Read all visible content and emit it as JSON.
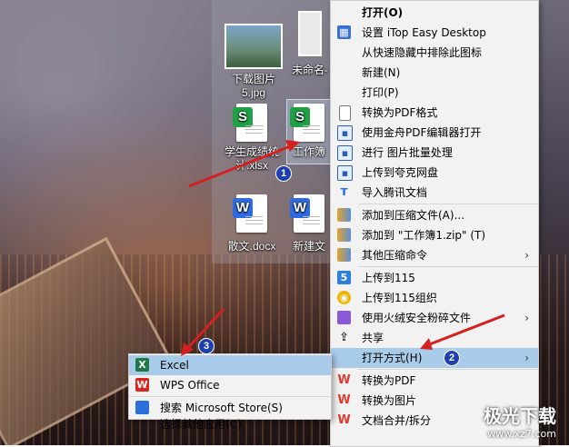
{
  "desktop": {
    "icons": [
      {
        "label": "下载图片5.jpg",
        "label_l1": "下载图片",
        "label_l2": "5.jpg"
      },
      {
        "label": "未命名-",
        "label_l1": "未命名-"
      },
      {
        "label": "学生成绩统计.xlsx",
        "label_l1": "学生成绩统",
        "label_l2": "计.xlsx",
        "badge": "S"
      },
      {
        "label": "工作簿1",
        "label_l1": "工作簿",
        "badge": "S"
      },
      {
        "label": "散文.docx",
        "label_l1": "散文.docx",
        "badge": "W"
      },
      {
        "label": "新建文",
        "label_l1": "新建文",
        "badge": "W"
      }
    ]
  },
  "context_menu": {
    "items": [
      {
        "label": "打开(O)",
        "icon": ""
      },
      {
        "label": "设置 iTop Easy Desktop",
        "icon": "itop-icon"
      },
      {
        "label": "从快速隐藏中排除此图标",
        "icon": ""
      },
      {
        "label": "新建(N)",
        "icon": ""
      },
      {
        "label": "打印(P)",
        "icon": ""
      },
      {
        "label": "转换为PDF格式",
        "icon": "document-icon"
      },
      {
        "label": "使用金舟PDF编辑器打开",
        "icon": "pdf-editor-icon"
      },
      {
        "label": "进行 图片批量处理",
        "icon": "image-batch-icon"
      },
      {
        "label": "上传到夸克网盘",
        "icon": "cloud-icon"
      },
      {
        "label": "导入腾讯文档",
        "icon": "tencent-docs-icon"
      },
      {
        "label": "添加到压缩文件(A)...",
        "icon": "archive-icon"
      },
      {
        "label": "添加到 \"工作簿1.zip\" (T)",
        "icon": "archive-icon"
      },
      {
        "label": "其他压缩命令",
        "icon": "archive-icon"
      },
      {
        "label": "上传到115",
        "icon": "115-icon"
      },
      {
        "label": "上传到115组织",
        "icon": "115-org-icon"
      },
      {
        "label": "使用火绒安全粉碎文件",
        "icon": "shred-icon"
      },
      {
        "label": "共享",
        "icon": "share-icon"
      },
      {
        "label": "打开方式(H)",
        "icon": ""
      },
      {
        "label": "转换为PDF",
        "icon": "wps-icon"
      },
      {
        "label": "转换为图片",
        "icon": "wps-icon"
      },
      {
        "label": "文档合并/拆分",
        "icon": "wps-icon"
      }
    ],
    "arrow_glyph": "›"
  },
  "open_with_menu": {
    "items": [
      {
        "label": "Excel",
        "icon": "excel-icon"
      },
      {
        "label": "WPS Office",
        "icon": "wps-office-icon"
      },
      {
        "label": "搜索 Microsoft Store(S)",
        "icon": "store-icon"
      },
      {
        "label": "选择其他应用(C)",
        "icon": ""
      }
    ]
  },
  "annotations": {
    "n1": "1",
    "n2": "2",
    "n3": "3"
  },
  "watermark": {
    "brand": "极光下载",
    "site": "www.xz7.com"
  },
  "colors": {
    "highlight": "#a9cbea",
    "annotation_arrow": "#d42020",
    "badge_blue": "#1d3fb0"
  }
}
